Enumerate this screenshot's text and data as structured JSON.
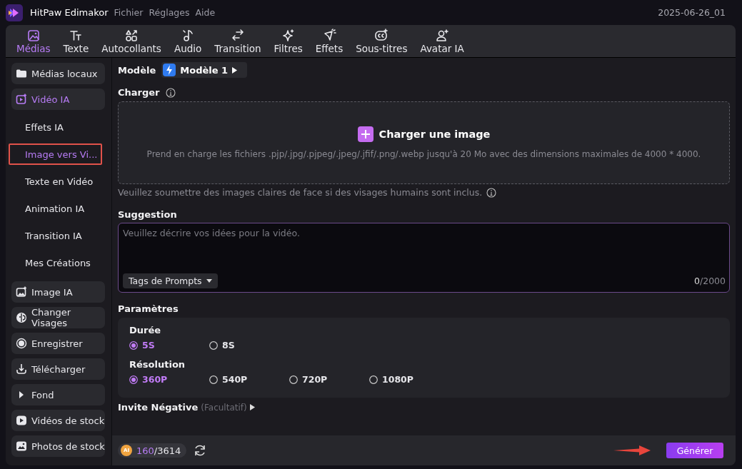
{
  "app": {
    "name": "HitPaw Edimakor",
    "menu": [
      "Fichier",
      "Réglages",
      "Aide"
    ],
    "version": "2025-06-26_01"
  },
  "toolbar": [
    {
      "label": "Médias",
      "selected": true
    },
    {
      "label": "Texte",
      "selected": false
    },
    {
      "label": "Autocollants",
      "selected": false
    },
    {
      "label": "Audio",
      "selected": false
    },
    {
      "label": "Transition",
      "selected": false
    },
    {
      "label": "Filtres",
      "selected": false
    },
    {
      "label": "Effets",
      "selected": false
    },
    {
      "label": "Sous-titres",
      "selected": false
    },
    {
      "label": "Avatar IA",
      "selected": false
    }
  ],
  "sidebar": [
    {
      "label": "Médias locaux",
      "selected": false
    },
    {
      "label": "Vidéo IA",
      "selected": true,
      "children": [
        {
          "label": "Effets IA",
          "selected": false,
          "highlighted": false
        },
        {
          "label": "Image vers Vi...",
          "selected": true,
          "highlighted": true
        },
        {
          "label": "Texte en Vidéo",
          "selected": false,
          "highlighted": false
        },
        {
          "label": "Animation IA",
          "selected": false,
          "highlighted": false
        },
        {
          "label": "Transition IA",
          "selected": false,
          "highlighted": false
        },
        {
          "label": "Mes Créations",
          "selected": false,
          "highlighted": false
        }
      ]
    },
    {
      "label": "Image IA",
      "selected": false
    },
    {
      "label": "Changer Visages",
      "selected": false
    },
    {
      "label": "Enregistrer",
      "selected": false
    },
    {
      "label": "Télécharger",
      "selected": false
    },
    {
      "label": "Fond",
      "selected": false
    },
    {
      "label": "Vidéos de stock",
      "selected": false
    },
    {
      "label": "Photos de stock",
      "selected": false
    }
  ],
  "model": {
    "label": "Modèle",
    "value": "Modèle 1"
  },
  "upload": {
    "label": "Charger",
    "button": "Charger une image",
    "hint": "Prend en charge les fichiers .pjp/.jpg/.pjpeg/.jpeg/.jfif/.png/.webp jusqu'à 20 Mo avec des dimensions maximales de 4000 * 4000.",
    "note": "Veuillez soumettre des images claires de face si des visages humains sont inclus."
  },
  "suggestion": {
    "label": "Suggestion",
    "placeholder": "Veuillez décrire vos idées pour la vidéo.",
    "tags_button": "Tags de Prompts",
    "count": "0",
    "limit": "/2000"
  },
  "parameters": {
    "label": "Paramètres",
    "groups": [
      {
        "label": "Durée",
        "options": [
          {
            "label": "5S",
            "selected": true
          },
          {
            "label": "8S",
            "selected": false
          }
        ]
      },
      {
        "label": "Résolution",
        "options": [
          {
            "label": "360P",
            "selected": true
          },
          {
            "label": "540P",
            "selected": false
          },
          {
            "label": "720P",
            "selected": false
          },
          {
            "label": "1080P",
            "selected": false
          }
        ]
      }
    ]
  },
  "negative": {
    "label": "Invite Négative",
    "optional": "(Facultatif)"
  },
  "footer": {
    "coin": "AI",
    "credits": "160",
    "total": "/3614",
    "generate": "Générer"
  }
}
